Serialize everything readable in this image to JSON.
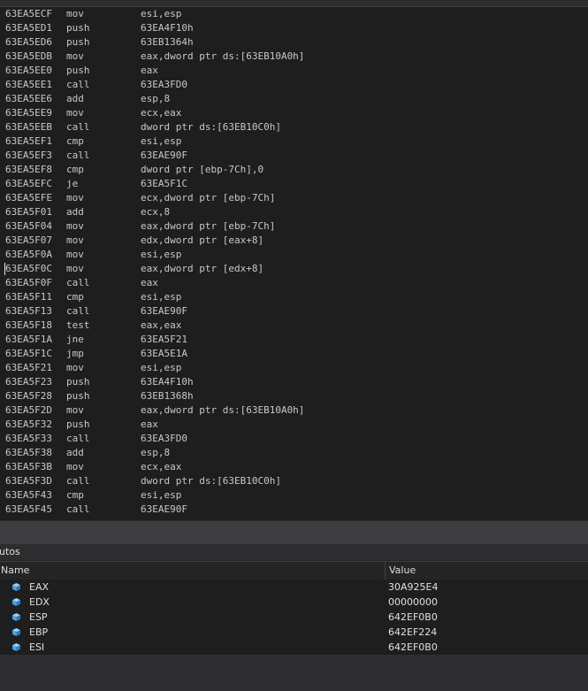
{
  "disassembly": [
    {
      "addr": "63EA5ECF",
      "mn": "mov",
      "op": "esi,esp"
    },
    {
      "addr": "63EA5ED1",
      "mn": "push",
      "op": "63EA4F10h"
    },
    {
      "addr": "63EA5ED6",
      "mn": "push",
      "op": "63EB1364h"
    },
    {
      "addr": "63EA5EDB",
      "mn": "mov",
      "op": "eax,dword ptr ds:[63EB10A0h]"
    },
    {
      "addr": "63EA5EE0",
      "mn": "push",
      "op": "eax"
    },
    {
      "addr": "63EA5EE1",
      "mn": "call",
      "op": "63EA3FD0"
    },
    {
      "addr": "63EA5EE6",
      "mn": "add",
      "op": "esp,8"
    },
    {
      "addr": "63EA5EE9",
      "mn": "mov",
      "op": "ecx,eax"
    },
    {
      "addr": "63EA5EEB",
      "mn": "call",
      "op": "dword ptr ds:[63EB10C0h]"
    },
    {
      "addr": "63EA5EF1",
      "mn": "cmp",
      "op": "esi,esp"
    },
    {
      "addr": "63EA5EF3",
      "mn": "call",
      "op": "63EAE90F"
    },
    {
      "addr": "63EA5EF8",
      "mn": "cmp",
      "op": "dword ptr [ebp-7Ch],0"
    },
    {
      "addr": "63EA5EFC",
      "mn": "je",
      "op": "63EA5F1C"
    },
    {
      "addr": "63EA5EFE",
      "mn": "mov",
      "op": "ecx,dword ptr [ebp-7Ch]"
    },
    {
      "addr": "63EA5F01",
      "mn": "add",
      "op": "ecx,8"
    },
    {
      "addr": "63EA5F04",
      "mn": "mov",
      "op": "eax,dword ptr [ebp-7Ch]"
    },
    {
      "addr": "63EA5F07",
      "mn": "mov",
      "op": "edx,dword ptr [eax+8]"
    },
    {
      "addr": "63EA5F0A",
      "mn": "mov",
      "op": "esi,esp"
    },
    {
      "addr": "63EA5F0C",
      "mn": "mov",
      "op": "eax,dword ptr [edx+8]"
    },
    {
      "addr": "63EA5F0F",
      "mn": "call",
      "op": "eax"
    },
    {
      "addr": "63EA5F11",
      "mn": "cmp",
      "op": "esi,esp"
    },
    {
      "addr": "63EA5F13",
      "mn": "call",
      "op": "63EAE90F"
    },
    {
      "addr": "63EA5F18",
      "mn": "test",
      "op": "eax,eax"
    },
    {
      "addr": "63EA5F1A",
      "mn": "jne",
      "op": "63EA5F21"
    },
    {
      "addr": "63EA5F1C",
      "mn": "jmp",
      "op": "63EA5E1A"
    },
    {
      "addr": "63EA5F21",
      "mn": "mov",
      "op": "esi,esp"
    },
    {
      "addr": "63EA5F23",
      "mn": "push",
      "op": "63EA4F10h"
    },
    {
      "addr": "63EA5F28",
      "mn": "push",
      "op": "63EB1368h"
    },
    {
      "addr": "63EA5F2D",
      "mn": "mov",
      "op": "eax,dword ptr ds:[63EB10A0h]"
    },
    {
      "addr": "63EA5F32",
      "mn": "push",
      "op": "eax"
    },
    {
      "addr": "63EA5F33",
      "mn": "call",
      "op": "63EA3FD0"
    },
    {
      "addr": "63EA5F38",
      "mn": "add",
      "op": "esp,8"
    },
    {
      "addr": "63EA5F3B",
      "mn": "mov",
      "op": "ecx,eax"
    },
    {
      "addr": "63EA5F3D",
      "mn": "call",
      "op": "dword ptr ds:[63EB10C0h]"
    },
    {
      "addr": "63EA5F43",
      "mn": "cmp",
      "op": "esi,esp"
    },
    {
      "addr": "63EA5F45",
      "mn": "call",
      "op": "63EAE90F"
    }
  ],
  "autos": {
    "title": "utos",
    "header": {
      "name": "Name",
      "value": "Value"
    },
    "rows": [
      {
        "name": "EAX",
        "value": "30A925E4",
        "icon": "register-icon"
      },
      {
        "name": "EDX",
        "value": "00000000",
        "icon": "register-icon"
      },
      {
        "name": "ESP",
        "value": "642EF0B0",
        "icon": "register-icon"
      },
      {
        "name": "EBP",
        "value": "642EF224",
        "icon": "register-icon"
      },
      {
        "name": "ESI",
        "value": "642EF0B0",
        "icon": "register-icon"
      }
    ]
  },
  "colors": {
    "icon": "#4aa3e8"
  }
}
